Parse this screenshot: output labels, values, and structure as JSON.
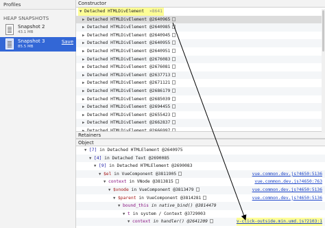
{
  "sidebar": {
    "title": "Profiles",
    "section": "HEAP SNAPSHOTS",
    "snapshots": [
      {
        "name": "Snapshot 2",
        "size": "43.1 MB"
      },
      {
        "name": "Snapshot 3",
        "size": "85.5 MB",
        "action": "Save"
      }
    ]
  },
  "constructor": {
    "header": "Constructor",
    "group": {
      "label": "Detached HTMLDivElement",
      "count": "×8641"
    },
    "rows": [
      "Detached HTMLDivElement @2640965",
      "Detached HTMLDivElement @2640985",
      "Detached HTMLDivElement @2640945",
      "Detached HTMLDivElement @2640955",
      "Detached HTMLDivElement @2640951",
      "Detached HTMLDivElement @2676083",
      "Detached HTMLDivElement @2676081",
      "Detached HTMLDivElement @2637713",
      "Detached HTMLDivElement @2671121",
      "Detached HTMLDivElement @2686179",
      "Detached HTMLDivElement @2685039",
      "Detached HTMLDivElement @2694455",
      "Detached HTMLDivElement @2655423",
      "Detached HTMLDivElement @2662837",
      "Detached HTMLDivElement @2666997"
    ]
  },
  "retainers": {
    "header": "Retainers",
    "column": "Object",
    "rows": [
      {
        "key": "[7]",
        "rest": " in Detached HTMLElement @2640975",
        "link": ""
      },
      {
        "key": "[4]",
        "rest": " in Detached Text @2690085",
        "link": ""
      },
      {
        "key": "[9]",
        "rest": " in Detached HTMLElement @2690083",
        "link": ""
      },
      {
        "key": "$el",
        "rest": " in VueComponent @3811905",
        "link": "vue.common.dev.js?4650:5136"
      },
      {
        "key": "context",
        "rest": " in VNode @3813815",
        "link": "vue.common.dev.js?4650:763"
      },
      {
        "key": "$vnode",
        "rest": " in VueComponent @3813479",
        "link": "vue.common.dev.js?4650:5136"
      },
      {
        "key": "$parent",
        "rest": " in VueComponent @3814281",
        "link": "vue.common.dev.js?4650:5136"
      },
      {
        "key": "bound_this",
        "rest": " in native_bind() @3814479",
        "link": ""
      },
      {
        "key": "t",
        "rest": " in system / Context @3729003",
        "link": ""
      },
      {
        "key": "context",
        "rest": " in handler() @2641209",
        "link": "v-click-outside.min.umd.js?2103:1"
      }
    ]
  }
}
